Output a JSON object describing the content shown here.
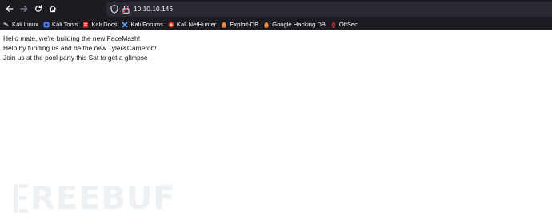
{
  "browser": {
    "url": "10.10.10.146",
    "nav": {
      "back_icon": "arrow-left-icon",
      "forward_icon": "arrow-right-icon",
      "reload_icon": "reload-icon",
      "home_icon": "home-icon"
    },
    "bookmarks": [
      {
        "label": "Kali Linux",
        "icon": "kali-dragon-icon",
        "color": "#c8c8c8"
      },
      {
        "label": "Kali Tools",
        "icon": "kali-tools-icon",
        "color": "#4f7cff"
      },
      {
        "label": "Kali Docs",
        "icon": "kali-docs-icon",
        "color": "#e0301e"
      },
      {
        "label": "Kali Forums",
        "icon": "kali-forums-icon",
        "color": "#5aa9ff"
      },
      {
        "label": "Kali NetHunter",
        "icon": "nethunter-icon",
        "color": "#e0301e"
      },
      {
        "label": "Exploit-DB",
        "icon": "exploit-db-icon",
        "color": "#f0883e"
      },
      {
        "label": "Google Hacking DB",
        "icon": "ghdb-icon",
        "color": "#f0883e"
      },
      {
        "label": "OffSec",
        "icon": "offsec-icon",
        "color": "#e0301e"
      }
    ],
    "colors": {
      "chrome_bg": "#1c1b22",
      "urlbar_bg": "#2b2a33",
      "text": "#fbfbfe"
    }
  },
  "page": {
    "lines": [
      "Hello mate, we're building the new FaceMash!",
      "Help by funding us and be the new Tyler&Cameron!",
      "Join us at the pool party this Sat to get a glimpse"
    ]
  },
  "watermark": {
    "text": "REEBUF",
    "icon": "freebuf-logo-icon"
  }
}
